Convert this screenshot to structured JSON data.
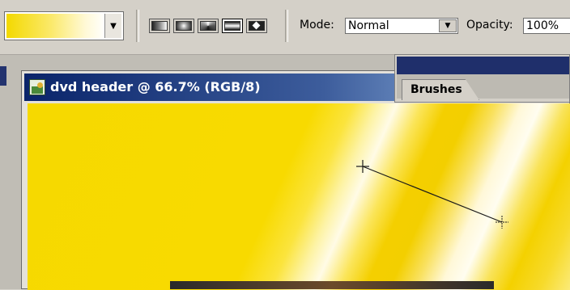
{
  "options_bar": {
    "gradient_picker": {
      "icon": "dropdown-arrow",
      "colors": [
        "#f3d900",
        "#fbe96a",
        "#ffffff"
      ]
    },
    "gradient_types": [
      {
        "name": "linear-gradient",
        "icon": "linear-gradient-icon",
        "active": false
      },
      {
        "name": "radial-gradient",
        "icon": "radial-gradient-icon",
        "active": false
      },
      {
        "name": "angle-gradient",
        "icon": "angle-gradient-icon",
        "active": false
      },
      {
        "name": "reflected-gradient",
        "icon": "reflected-gradient-icon",
        "active": true
      },
      {
        "name": "diamond-gradient",
        "icon": "diamond-gradient-icon",
        "active": false
      }
    ],
    "mode": {
      "label": "Mode:",
      "value": "Normal"
    },
    "opacity": {
      "label": "Opacity:",
      "value": "100%"
    }
  },
  "document": {
    "title": "dvd header @ 66.7% (RGB/8)",
    "icon": "image-document-icon",
    "canvas_colors": {
      "yellow": "#f6d900",
      "light": "#fffbe6"
    }
  },
  "palette": {
    "tab_label": "Brushes",
    "titlebar_color": "#1f2f6b"
  },
  "colors": {
    "chrome": "#d4d0c8",
    "title_active": "#0a246a"
  }
}
